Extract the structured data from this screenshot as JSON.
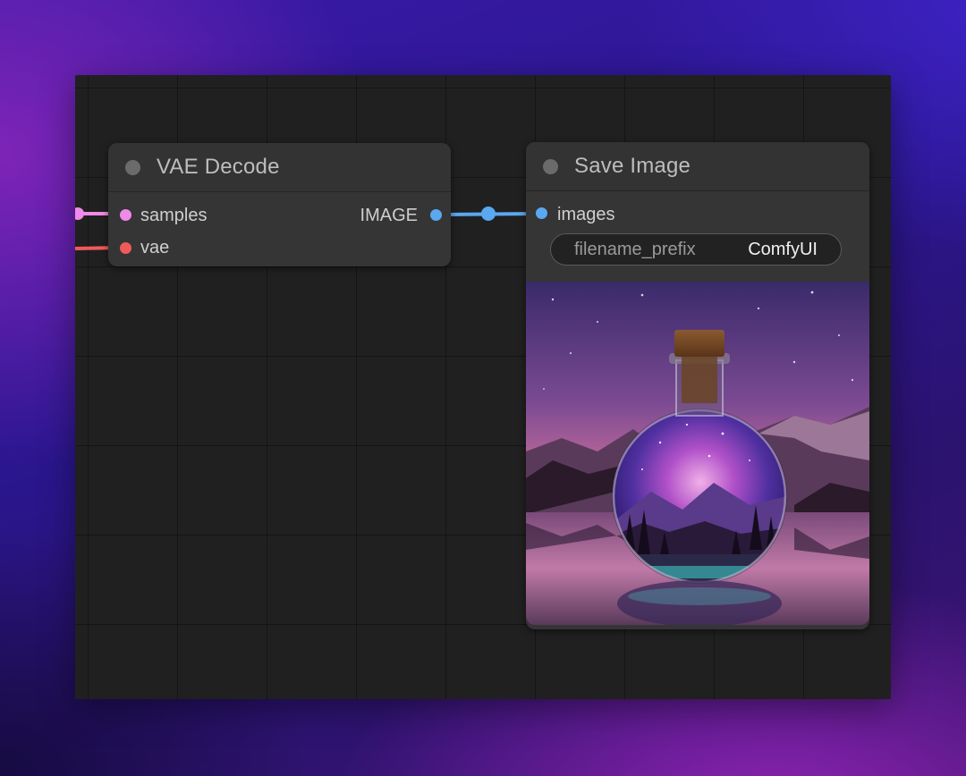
{
  "nodes": {
    "vae_decode": {
      "title": "VAE Decode",
      "inputs": [
        {
          "label": "samples",
          "color": "#f08ae8"
        },
        {
          "label": "vae",
          "color": "#f05a5a"
        }
      ],
      "outputs": [
        {
          "label": "IMAGE",
          "color": "#5aa8f0"
        }
      ]
    },
    "save_image": {
      "title": "Save Image",
      "inputs": [
        {
          "label": "images",
          "color": "#5aa8f0"
        }
      ],
      "widgets": [
        {
          "name": "filename_prefix",
          "value": "ComfyUI"
        }
      ]
    }
  },
  "colors": {
    "canvas": "#202020",
    "node_body": "#353535",
    "link_image": "#5aa8f0",
    "link_latent": "#f08ae8",
    "link_vae": "#f05a5a"
  },
  "icons": {
    "title_dot": "collapse-dot-icon",
    "preview": "potion-bottle-galaxy-image"
  }
}
